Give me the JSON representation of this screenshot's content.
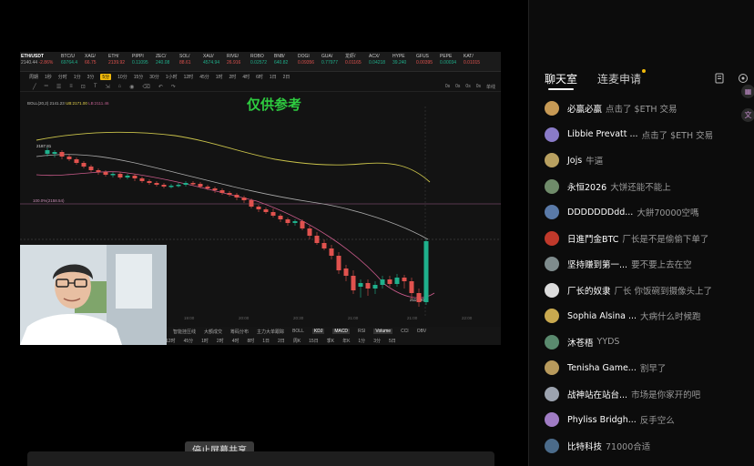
{
  "chart": {
    "main_ticker": {
      "symbol": "ETH/USDT",
      "price": "2140.44",
      "change": "-2.86%"
    },
    "tickers": [
      {
        "symbol": "BTC/U",
        "price": "69764.4",
        "dir": "up"
      },
      {
        "symbol": "XAG/",
        "price": "66.75",
        "dir": "down"
      },
      {
        "symbol": "ETH/",
        "price": "2139.92",
        "dir": "down"
      },
      {
        "symbol": "PIPPI",
        "price": "0.11095",
        "dir": "up"
      },
      {
        "symbol": "ZEC/",
        "price": "240.08",
        "dir": "up"
      },
      {
        "symbol": "SOL/",
        "price": "88.61",
        "dir": "down"
      },
      {
        "symbol": "XAU/",
        "price": "4574.94",
        "dir": "up"
      },
      {
        "symbol": "RIVE/",
        "price": "26.916",
        "dir": "down"
      },
      {
        "symbol": "ROBO",
        "price": "0.02572",
        "dir": "up"
      },
      {
        "symbol": "BNB/",
        "price": "640.82",
        "dir": "up"
      },
      {
        "symbol": "DOGI",
        "price": "0.09356",
        "dir": "down"
      },
      {
        "symbol": "GUA/",
        "price": "0.77977",
        "dir": "up"
      },
      {
        "symbol": "龙虾/",
        "price": "0.01165",
        "dir": "down"
      },
      {
        "symbol": "ACX/",
        "price": "0.04218",
        "dir": "up"
      },
      {
        "symbol": "HYPE",
        "price": "39.240",
        "dir": "up"
      },
      {
        "symbol": "GFUS",
        "price": "0.00395",
        "dir": "down"
      },
      {
        "symbol": "PEPE",
        "price": "0.00034",
        "dir": "up"
      },
      {
        "symbol": "KAT/",
        "price": "0.01015",
        "dir": "down"
      }
    ],
    "timeframes": [
      "周期",
      "1秒",
      "分时",
      "1分",
      "3分",
      "5分",
      "10分",
      "15分",
      "30分",
      "1小时",
      "12时",
      "45分",
      "1时",
      "2时",
      "4时",
      "6时",
      "1日",
      "2日"
    ],
    "active_timeframe": "5分",
    "tool_right": [
      "0s",
      "0s",
      "0s",
      "0s",
      "单线"
    ],
    "boll_label": {
      "base": "BOLL(20,2)",
      "mid": "2141.23",
      "up": "UB:2171.00",
      "lo": "LB:2111.46"
    },
    "ref_text": "仅供参考",
    "price_high": "2187.81",
    "price_low": "2110.90",
    "price_line": "100.0%(2158.54)",
    "time_labels": [
      "19:00",
      "20:00",
      "20:30",
      "21:00",
      "21:00",
      "22:00"
    ],
    "indicator_row": [
      "智能挂压线",
      "大额成交",
      "筹码分布",
      "主力大单跟踪",
      "BOLL",
      "KDJ",
      "MACD",
      "RSI",
      "Volume",
      "CCI",
      "OBV"
    ],
    "active_indicators": [
      "KDJ",
      "MACD",
      "Volume"
    ],
    "period_row": [
      "12时",
      "45分",
      "1时",
      "2时",
      "4时",
      "8时",
      "1日",
      "2日",
      "周K",
      "15日",
      "季K",
      "年K",
      "1分",
      "3分",
      "5日"
    ]
  },
  "stop_share_label": "停止屏幕共享",
  "chat": {
    "tabs": [
      {
        "label": "聊天室",
        "active": true
      },
      {
        "label": "连麦申请",
        "active": false
      }
    ],
    "messages": [
      {
        "user": "必赢必赢",
        "text": "点击了 $ETH 交易",
        "color": "#c79a55"
      },
      {
        "user": "Libbie Prevatt ...",
        "text": "点击了 $ETH 交易",
        "color": "#8a7bc8"
      },
      {
        "user": "Jojs",
        "text": "牛逼",
        "color": "#b8a060"
      },
      {
        "user": "永恒2026",
        "text": "大饼还能不能上",
        "color": "#6f8b6a"
      },
      {
        "user": "DDDDDDDdd...",
        "text": "大餅70000空嗎",
        "color": "#5a7aa8"
      },
      {
        "user": "日進鬥金BTC",
        "text": "厂长是不是偷偷下单了",
        "color": "#c0392b"
      },
      {
        "user": "坚持赚到第一...",
        "text": "要不要上去在空",
        "color": "#7f8c8d"
      },
      {
        "user": "厂长的奴隶",
        "text": "厂长 你饭碗到摄像头上了",
        "color": "#dcdcdc"
      },
      {
        "user": "Sophia Alsina ...",
        "text": "大病什么时候跑",
        "color": "#c9a94f"
      },
      {
        "user": "沐苍梧",
        "text": "YYDS",
        "color": "#5a8a6e"
      },
      {
        "user": "Tenisha Game...",
        "text": "割早了",
        "color": "#b89a5c"
      },
      {
        "user": "战神站在站台...",
        "text": "市场是你家开的吧",
        "color": "#9ca3af"
      },
      {
        "user": "Phyliss Bridgh...",
        "text": "反手空么",
        "color": "#a07cc4"
      },
      {
        "user": "比特科技",
        "text": "71000合适",
        "color": "#4b6b8a"
      }
    ]
  }
}
